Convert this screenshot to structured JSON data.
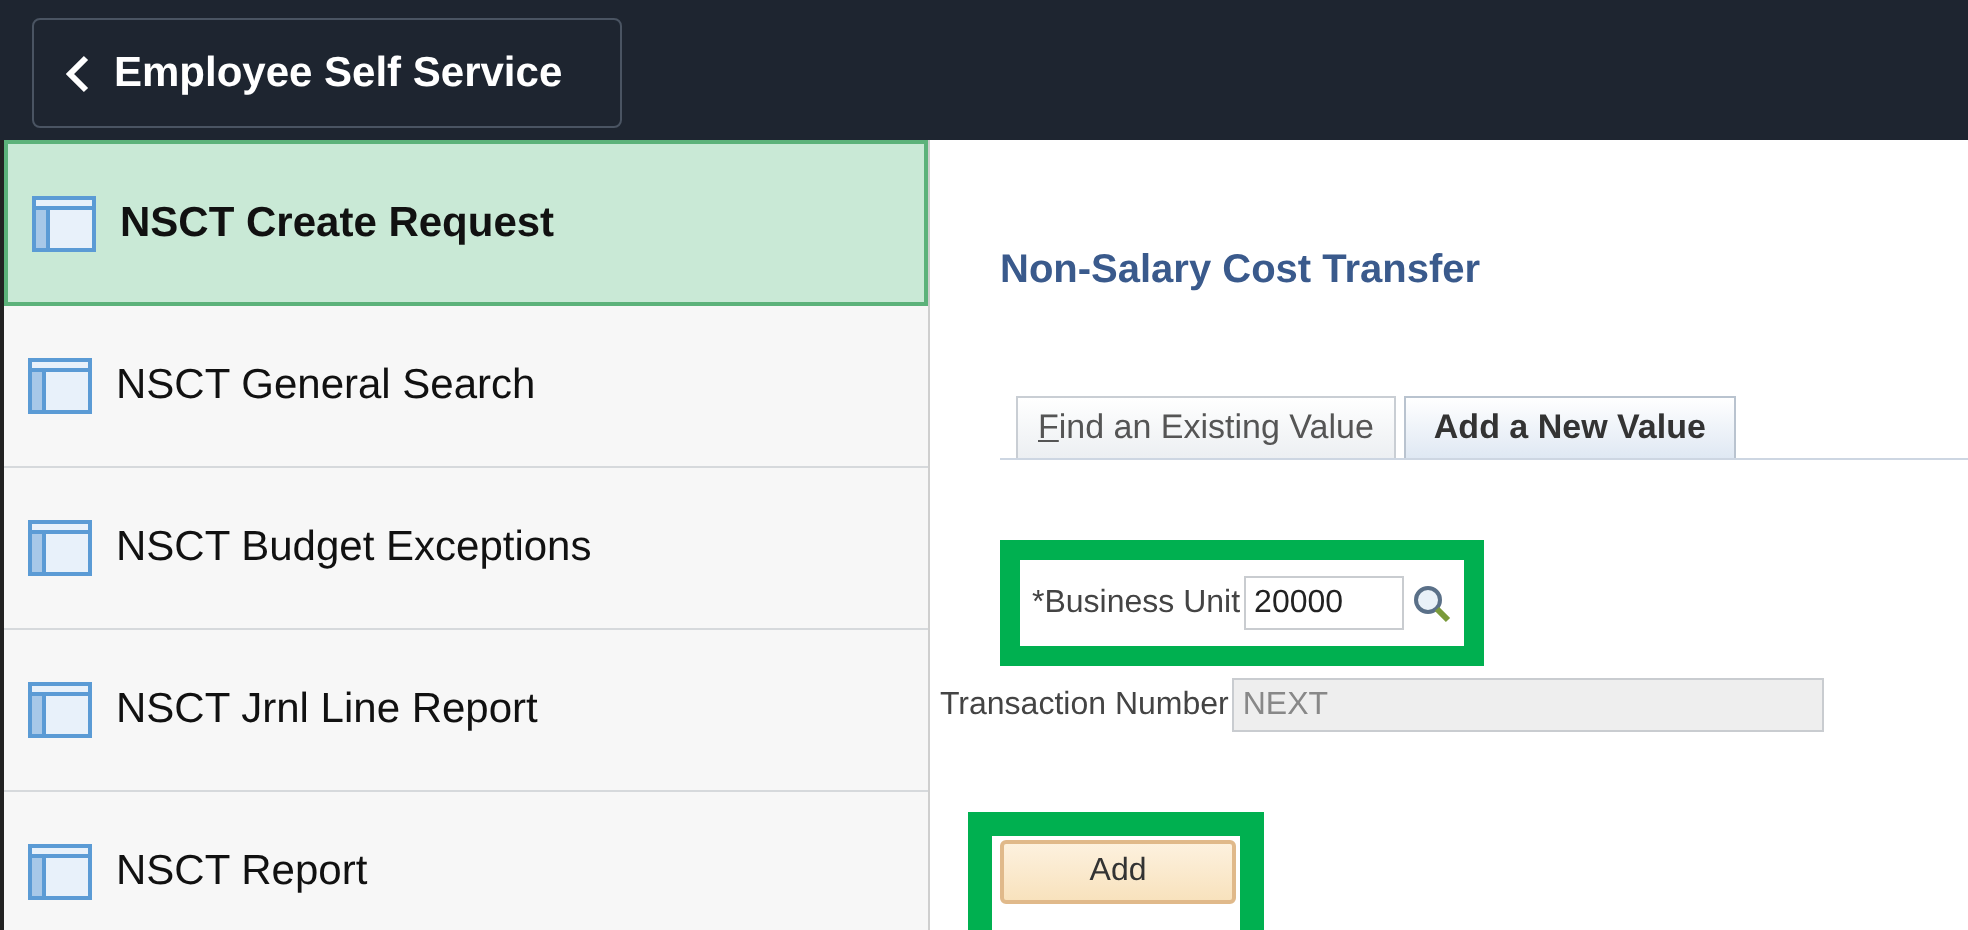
{
  "header": {
    "back_button": "Employee Self Service"
  },
  "sidebar": {
    "items": [
      {
        "label": "NSCT Create Request",
        "selected": true
      },
      {
        "label": "NSCT General Search",
        "selected": false
      },
      {
        "label": "NSCT Budget Exceptions",
        "selected": false
      },
      {
        "label": "NSCT Jrnl Line Report",
        "selected": false
      },
      {
        "label": "NSCT Report",
        "selected": false
      }
    ]
  },
  "page_title": "Non-Salary Cost Transfer",
  "tabs": [
    {
      "label": "Find an Existing Value",
      "selected": false
    },
    {
      "label": "Add a New Value",
      "selected": true
    }
  ],
  "fields": [
    {
      "label": "*Business Unit",
      "value": "20000",
      "lookup": true,
      "disabled": false,
      "highlighted": true
    },
    {
      "label": "Transaction Number",
      "value": "NEXT",
      "lookup": false,
      "disabled": true,
      "highlighted": false
    }
  ],
  "add_button": {
    "label": "Add",
    "highlighted": true
  }
}
